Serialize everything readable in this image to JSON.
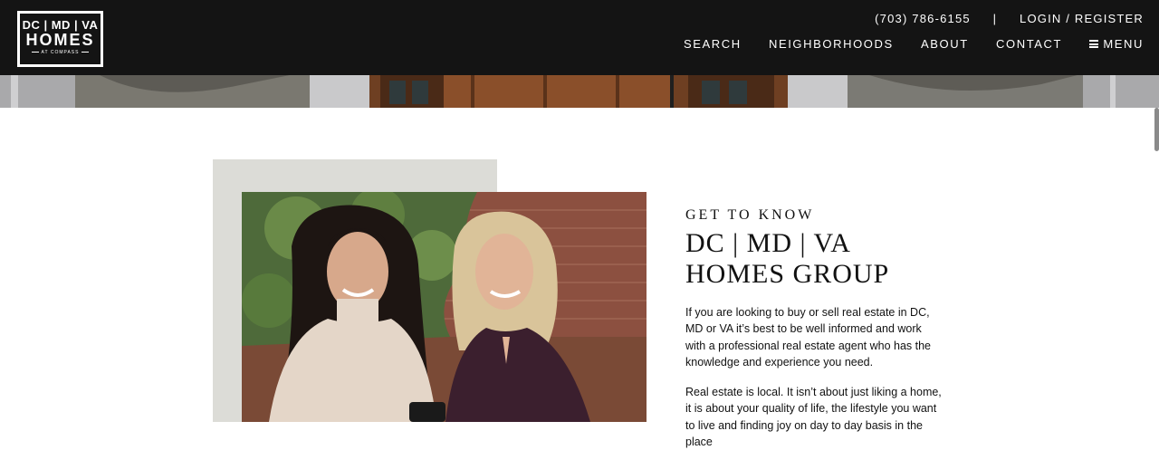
{
  "header": {
    "logo": {
      "line1": "DC | MD | VA",
      "line2": "HOMES",
      "line3": "AT COMPASS"
    },
    "phone": "(703) 786-6155",
    "separator": "|",
    "login": "LOGIN / REGISTER",
    "nav": [
      {
        "label": "SEARCH"
      },
      {
        "label": "NEIGHBORHOODS"
      },
      {
        "label": "ABOUT"
      },
      {
        "label": "CONTACT"
      }
    ],
    "menu_label": "MENU"
  },
  "about": {
    "eyebrow": "GET TO KNOW",
    "headline": "DC | MD | VA HOMES GROUP",
    "paragraph1": "If you are looking to buy or sell real estate in DC, MD or VA it’s best to be well informed and work with a professional real estate agent who has the knowledge and experience you need.",
    "paragraph2": "Real estate is local. It isn’t about just liking a home, it is about your quality of life, the lifestyle you want to live and finding joy on day to day basis in the place"
  },
  "colors": {
    "header_bg": "#141414",
    "accent_block": "#dcdcd7",
    "text": "#111111"
  },
  "icons": {
    "menu": "hamburger-icon"
  }
}
